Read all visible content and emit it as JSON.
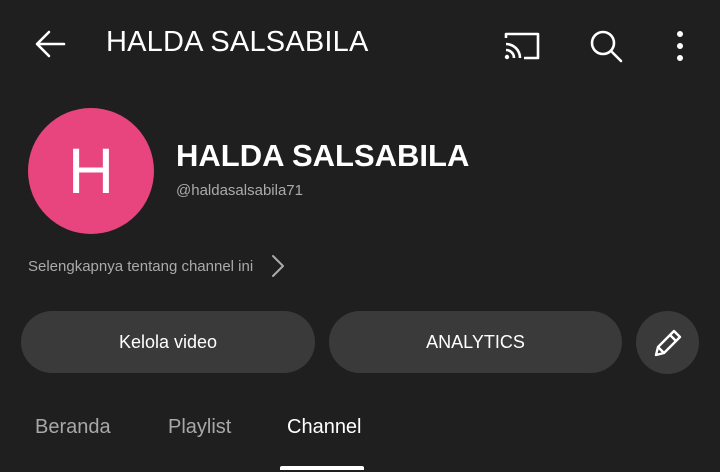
{
  "header": {
    "title": "HALDA SALSABILA"
  },
  "icons": {
    "back": "arrow-left-icon",
    "cast": "cast-icon",
    "search": "search-icon",
    "more": "more-vertical-icon",
    "chevron": "chevron-right-icon",
    "edit": "pencil-icon"
  },
  "channel": {
    "avatar_letter": "H",
    "avatar_color": "#e8457e",
    "name": "HALDA SALSABILA",
    "handle": "@haldasalsabila71",
    "about_label": "Selengkapnya tentang channel ini"
  },
  "actions": {
    "manage_videos_label": "Kelola video",
    "analytics_label": "ANALYTICS"
  },
  "tabs": [
    {
      "label": "Beranda",
      "active": false
    },
    {
      "label": "Playlist",
      "active": false
    },
    {
      "label": "Channel",
      "active": true
    }
  ],
  "colors": {
    "background": "#1f1f1f",
    "button_bg": "#3a3a3a",
    "secondary_text": "#aaaaaa"
  }
}
